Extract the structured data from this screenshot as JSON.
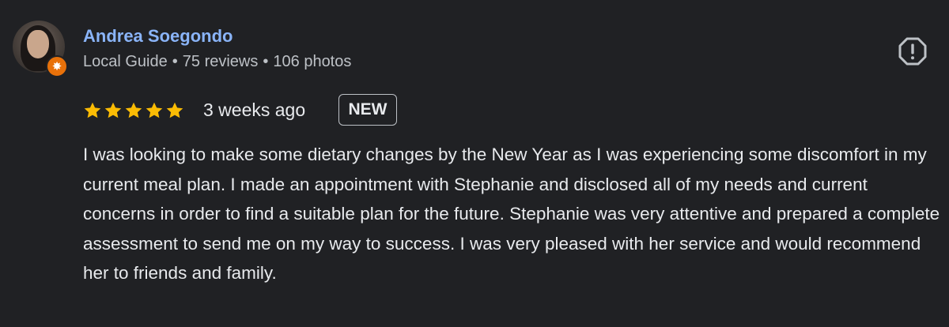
{
  "reviewer": {
    "name": "Andrea Soegondo",
    "level": "Local Guide",
    "separator": "•",
    "reviews": "75 reviews",
    "photos": "106 photos",
    "badge_color": "#e8710a",
    "badge_icon": "star-burst-icon"
  },
  "review": {
    "rating": 5,
    "max_rating": 5,
    "star_color": "#fbbc04",
    "time": "3 weeks ago",
    "new_badge": "NEW",
    "text": "I was looking to make some dietary changes by the New Year as I was experiencing some discomfort in my current meal plan. I made an appointment with Stephanie and disclosed all of my needs and current concerns in order to find a suitable plan for the future. Stephanie was very attentive and prepared a complete assessment to send me on my way to success. I was very pleased with her service and would recommend her to friends and family."
  },
  "actions": {
    "report_icon": "report-icon"
  },
  "colors": {
    "background": "#202124",
    "name": "#8ab4f8",
    "text": "#e8eaed",
    "secondary": "#bdc1c6"
  }
}
